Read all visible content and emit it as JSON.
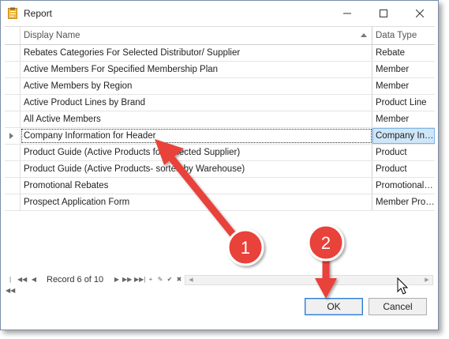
{
  "window": {
    "title": "Report"
  },
  "icons": {
    "app": "clipboard-icon",
    "minimize": "minimize-icon",
    "maximize": "maximize-icon",
    "close": "close-icon"
  },
  "grid": {
    "columns": [
      "Display Name",
      "Data Type"
    ],
    "rows": [
      {
        "name": " Rebates Categories For Selected Distributor/ Supplier",
        "type": "Rebate"
      },
      {
        "name": "Active Members For Specified Membership Plan",
        "type": "Member"
      },
      {
        "name": "Active Members by Region",
        "type": "Member"
      },
      {
        "name": "Active Product Lines by Brand",
        "type": "Product Line"
      },
      {
        "name": "All Active Members",
        "type": "Member"
      },
      {
        "name": "Company Information for Header",
        "type": "Company Information"
      },
      {
        "name": "Product Guide (Active Products for Selected Supplier)",
        "type": "Product"
      },
      {
        "name": "Product Guide (Active Products- sorted by Warehouse)",
        "type": "Product"
      },
      {
        "name": "Promotional Rebates",
        "type": "Promotional Rebates"
      },
      {
        "name": "Prospect Application Form",
        "type": "Member Prospect"
      }
    ],
    "focused_row": 5
  },
  "navigator": {
    "record_text": "Record 6 of 10"
  },
  "buttons": {
    "ok": "OK",
    "cancel": "Cancel"
  },
  "annotations": [
    {
      "label": "1"
    },
    {
      "label": "2"
    }
  ],
  "colors": {
    "annotation_red": "#e8423b",
    "selection": "#cfe6f7",
    "ok_border": "#2a7bd0"
  }
}
